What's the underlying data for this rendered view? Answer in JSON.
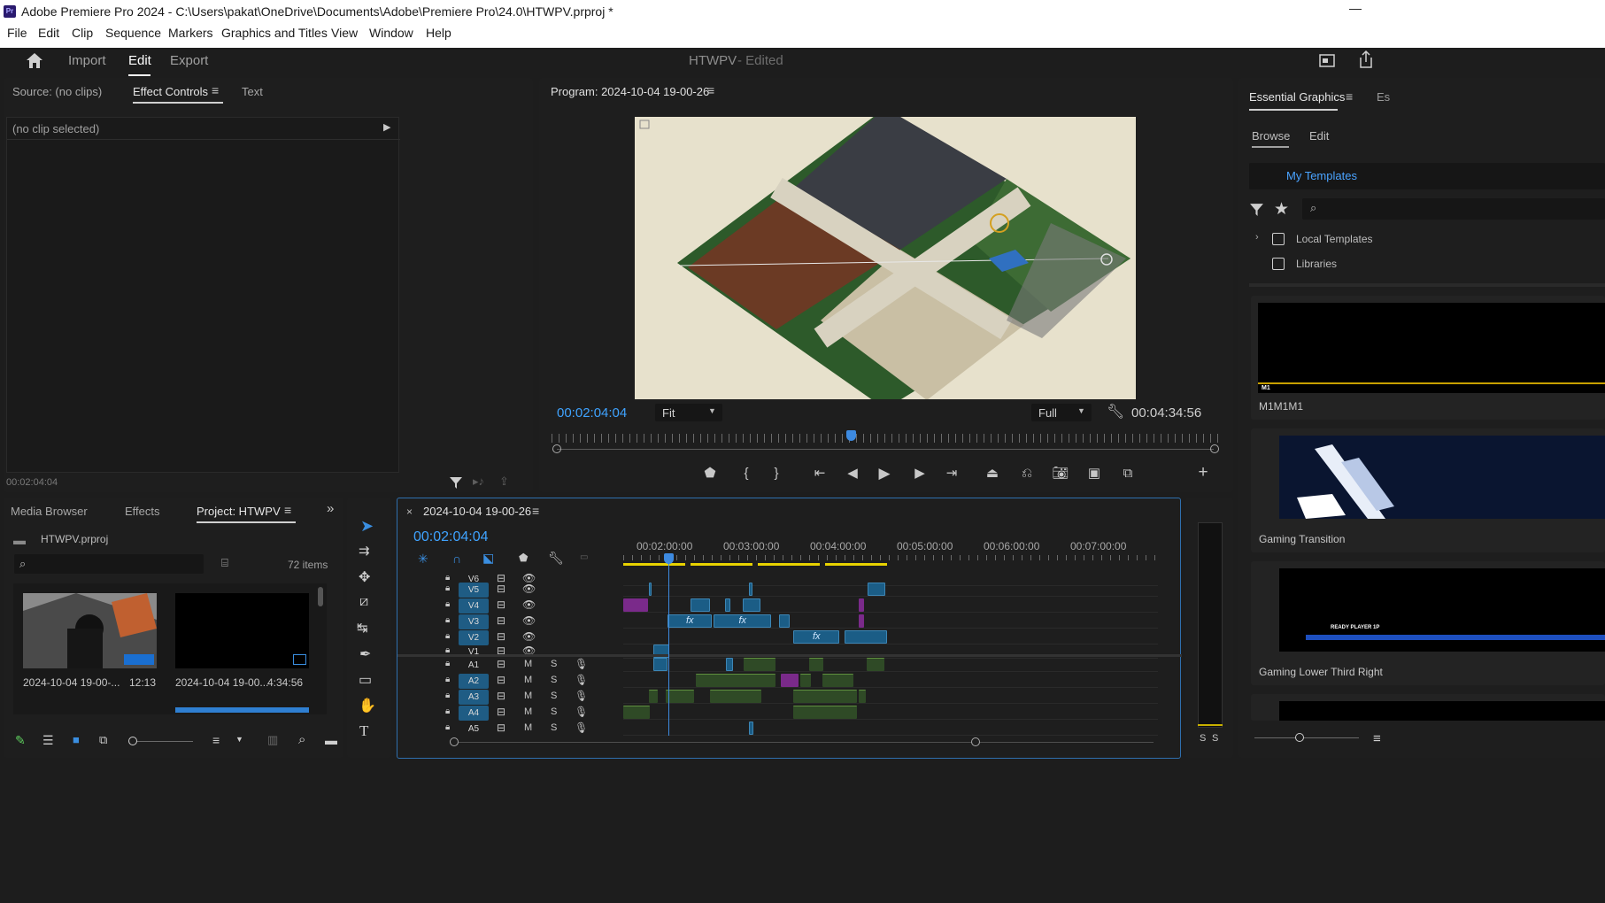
{
  "app": {
    "logo": "Pr",
    "title": "Adobe Premiere Pro 2024 - C:\\Users\\pakat\\OneDrive\\Documents\\Adobe\\Premiere Pro\\24.0\\HTWPV.prproj *",
    "minimize": "—"
  },
  "menu": [
    "File",
    "Edit",
    "Clip",
    "Sequence",
    "Markers",
    "Graphics and Titles",
    "View",
    "Window",
    "Help"
  ],
  "workspace": {
    "tabs": [
      "Import",
      "Edit",
      "Export"
    ],
    "active": "Edit",
    "project_name": "HTWPV",
    "status": "- Edited"
  },
  "source_panel": {
    "tabs": [
      "Source: (no clips)",
      "Effect Controls",
      "Text"
    ],
    "active": "Effect Controls",
    "no_clip": "(no clip selected)",
    "timecode": "00:02:04:04"
  },
  "program": {
    "title": "Program: 2024-10-04 19-00-26",
    "timecode": "00:02:04:04",
    "fit": "Fit",
    "quality": "Full",
    "duration": "00:04:34:56"
  },
  "essential_graphics": {
    "title": "Essential Graphics",
    "tab_cut": "Es",
    "subtabs": [
      "Browse",
      "Edit"
    ],
    "templates_button": "My Templates",
    "items": [
      "Local Templates",
      "Libraries"
    ],
    "templates": [
      "M1M1M1",
      "Gaming Transition",
      "Gaming Lower Third Right"
    ],
    "thumb_caption": "M1",
    "ready_text": "READY PLAYER 1P"
  },
  "project_panel": {
    "tabs": [
      "Media Browser",
      "Effects",
      "Project: HTWPV"
    ],
    "active": "Project: HTWPV",
    "file": "HTWPV.prproj",
    "items_count": "72 items",
    "clips": [
      {
        "name": "2024-10-04 19-00-...",
        "duration": "12:13"
      },
      {
        "name": "2024-10-04 19-00...",
        "duration": "4:34:56"
      }
    ]
  },
  "timeline": {
    "tab": "2024-10-04 19-00-26",
    "timecode": "00:02:04:04",
    "ruler": [
      "00:02:00:00",
      "00:03:00:00",
      "00:04:00:00",
      "00:05:00:00",
      "00:06:00:00",
      "00:07:00:00"
    ],
    "video_tracks": [
      "V6",
      "V5",
      "V4",
      "V3",
      "V2",
      "V1"
    ],
    "audio_tracks": [
      "A1",
      "A2",
      "A3",
      "A4",
      "A5"
    ],
    "m": "M",
    "s": "S",
    "fx": "fx",
    "playhead_fraction": 0.087
  },
  "meters": {
    "s_labels": [
      "S",
      "S"
    ]
  }
}
